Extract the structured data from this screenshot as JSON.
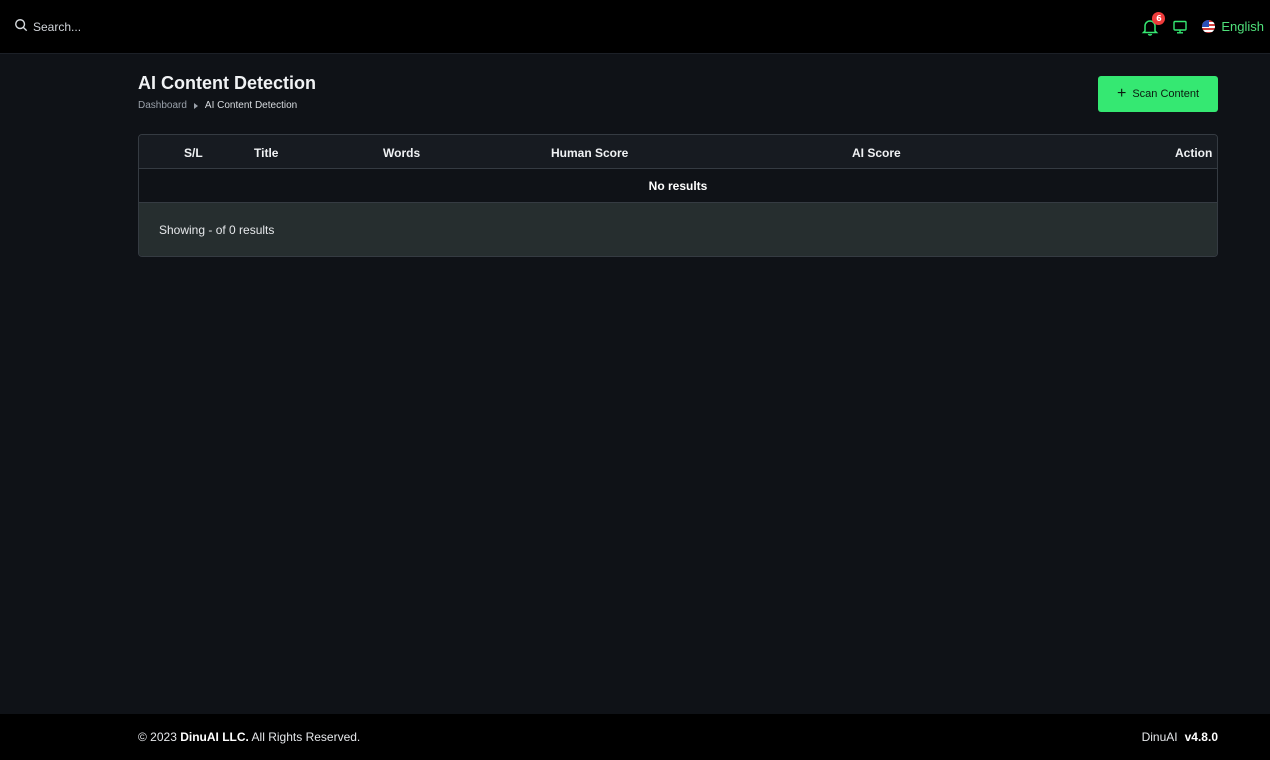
{
  "topbar": {
    "search_placeholder": "Search...",
    "notification_count": "6",
    "language": "English"
  },
  "page": {
    "title": "AI Content Detection",
    "breadcrumb": [
      "Dashboard",
      "AI Content Detection"
    ],
    "scan_button_label": "Scan Content"
  },
  "table": {
    "columns": [
      "S/L",
      "Title",
      "Words",
      "Human Score",
      "AI Score",
      "Action"
    ],
    "empty_message": "No results",
    "footer_text": "Showing - of 0 results"
  },
  "footer": {
    "copyright_prefix": "© 2023",
    "company": "DinuAI LLC.",
    "rights": "All Rights Reserved.",
    "product": "DinuAI",
    "version": "v4.8.0"
  },
  "colors": {
    "accent": "#35e872",
    "background": "#0f1217",
    "topbar": "#000000",
    "badge": "#ef3b3b"
  }
}
